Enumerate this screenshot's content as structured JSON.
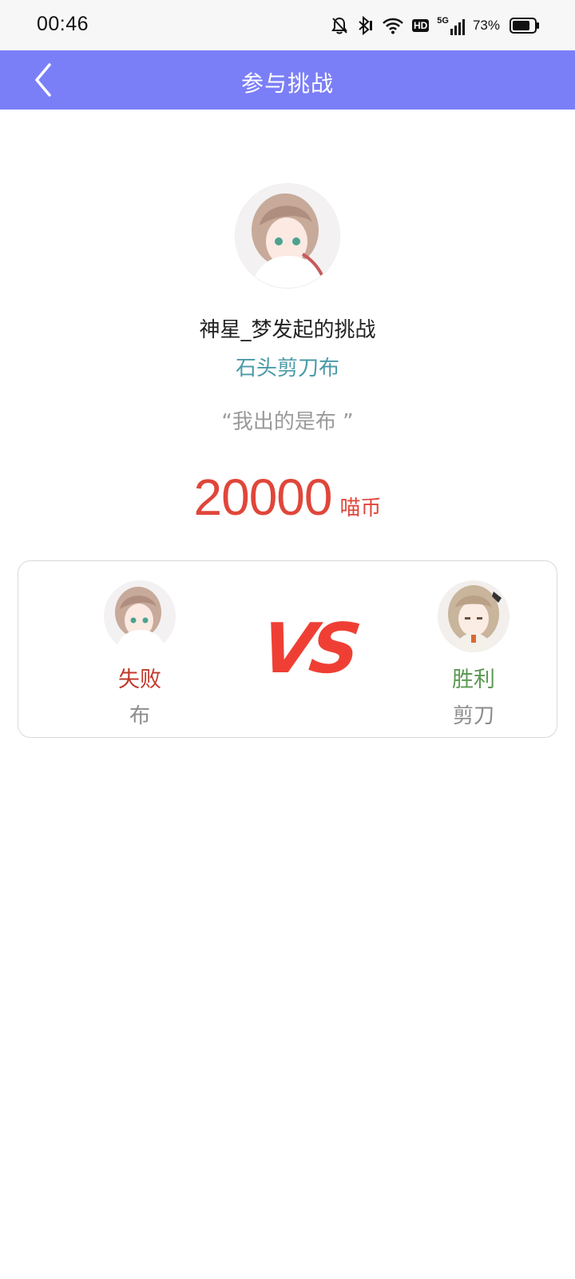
{
  "status_bar": {
    "time": "00:46",
    "hd": "HD",
    "network": "5G",
    "battery": "73%"
  },
  "nav": {
    "back_icon": "chevron-left-icon",
    "title": "参与挑战"
  },
  "challenge": {
    "title": "神星_梦发起的挑战",
    "game": "石头剪刀布",
    "quote": "“我出的是布 ”",
    "amount": "20000",
    "unit": "喵币"
  },
  "result": {
    "left": {
      "status": "失败",
      "choice": "布"
    },
    "vs": "VS",
    "right": {
      "status": "胜利",
      "choice": "剪刀"
    }
  },
  "colors": {
    "nav": "#7b7ff7",
    "game_name": "#4a9aa8",
    "prize": "#e0463a",
    "lose": "#c0392b",
    "win": "#5a9a52",
    "vs": "#ef3f34"
  }
}
